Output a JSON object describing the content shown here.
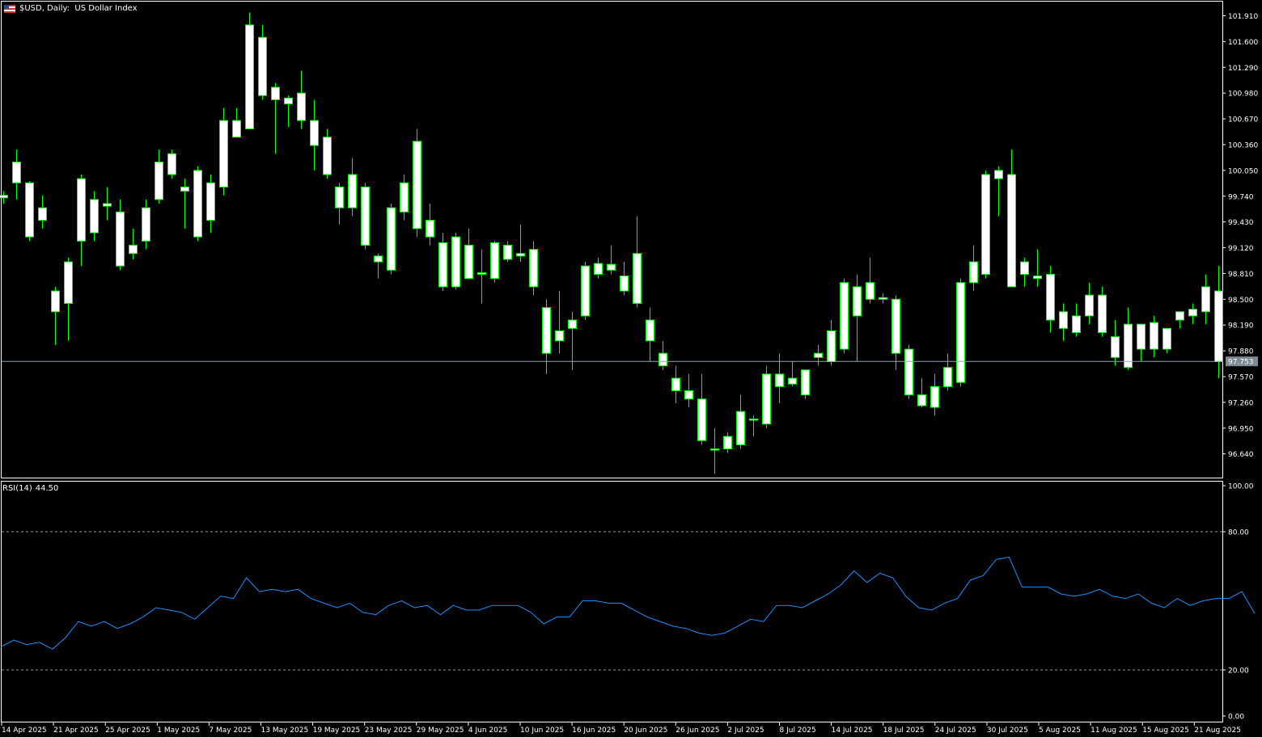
{
  "header": {
    "symbol": "$USD",
    "period": "Daily",
    "description": "US Dollar Index"
  },
  "indicator": {
    "name": "RSI(14)",
    "value": "44.50"
  },
  "current_price_label": "97.753",
  "colors": {
    "background": "#000000",
    "candle_wick": "#00ff00",
    "candle_body": "#ffffff",
    "rsi_line": "#1e90ff",
    "axis_text": "#ffffff",
    "price_line": "#8fa8b8",
    "level_line": "#9a9a9a"
  },
  "price_axis_labels": [
    "101.910",
    "101.600",
    "101.290",
    "100.980",
    "100.670",
    "100.360",
    "100.050",
    "99.740",
    "99.430",
    "99.120",
    "98.810",
    "98.500",
    "98.190",
    "97.880",
    "97.570",
    "97.260",
    "96.950",
    "96.640"
  ],
  "rsi_axis_labels": [
    "100.00",
    "80.00",
    "20.00",
    "0.00"
  ],
  "date_labels": [
    "14 Apr 2025",
    "21 Apr 2025",
    "25 Apr 2025",
    "1 May 2025",
    "7 May 2025",
    "13 May 2025",
    "19 May 2025",
    "23 May 2025",
    "29 May 2025",
    "4 Jun 2025",
    "10 Jun 2025",
    "16 Jun 2025",
    "20 Jun 2025",
    "26 Jun 2025",
    "2 Jul 2025",
    "8 Jul 2025",
    "14 Jul 2025",
    "18 Jul 2025",
    "24 Jul 2025",
    "30 Jul 2025",
    "5 Aug 2025",
    "11 Aug 2025",
    "15 Aug 2025",
    "21 Aug 2025"
  ],
  "chart_data": [
    {
      "type": "candlestick",
      "title": "$USD, Daily: US Dollar Index",
      "ylim": [
        96.3,
        102.0
      ],
      "current_price": 97.753,
      "grid": false,
      "ohlc": [
        [
          99.75,
          99.8,
          99.65,
          99.72
        ],
        [
          99.9,
          100.3,
          99.7,
          100.15
        ],
        [
          99.9,
          99.92,
          99.2,
          99.25
        ],
        [
          99.6,
          99.75,
          99.35,
          99.45
        ],
        [
          98.35,
          98.65,
          97.95,
          98.6
        ],
        [
          98.45,
          99.0,
          98.0,
          98.95
        ],
        [
          99.2,
          100.0,
          98.9,
          99.95
        ],
        [
          99.3,
          99.8,
          99.2,
          99.7
        ],
        [
          99.65,
          99.85,
          99.45,
          99.62
        ],
        [
          99.55,
          99.7,
          98.85,
          98.9
        ],
        [
          99.05,
          99.35,
          98.98,
          99.15
        ],
        [
          99.2,
          99.7,
          99.1,
          99.6
        ],
        [
          99.7,
          100.3,
          99.65,
          100.15
        ],
        [
          100.25,
          100.3,
          99.95,
          100.0
        ],
        [
          99.85,
          99.95,
          99.35,
          99.8
        ],
        [
          100.05,
          100.1,
          99.2,
          99.25
        ],
        [
          99.45,
          100.0,
          99.3,
          99.9
        ],
        [
          99.85,
          100.8,
          99.75,
          100.65
        ],
        [
          100.45,
          100.8,
          100.45,
          100.65
        ],
        [
          100.55,
          101.95,
          100.55,
          101.8
        ],
        [
          101.65,
          101.8,
          100.9,
          100.95
        ],
        [
          100.9,
          101.1,
          100.25,
          101.05
        ],
        [
          100.85,
          100.95,
          100.57,
          100.92
        ],
        [
          100.98,
          101.25,
          100.55,
          100.65
        ],
        [
          100.65,
          100.9,
          100.05,
          100.35
        ],
        [
          100.45,
          100.55,
          99.95,
          100.0
        ],
        [
          99.85,
          99.9,
          99.4,
          99.6
        ],
        [
          99.6,
          100.2,
          99.5,
          100.0
        ],
        [
          99.85,
          99.9,
          99.1,
          99.15
        ],
        [
          98.95,
          99.05,
          98.75,
          99.02
        ],
        [
          98.85,
          99.65,
          98.8,
          99.6
        ],
        [
          99.55,
          100.0,
          99.45,
          99.9
        ],
        [
          100.4,
          100.55,
          99.25,
          99.35
        ],
        [
          99.45,
          99.65,
          99.15,
          99.25
        ],
        [
          99.18,
          99.3,
          98.6,
          98.65
        ],
        [
          98.65,
          99.3,
          98.62,
          99.25
        ],
        [
          99.15,
          99.35,
          98.75,
          98.75
        ],
        [
          98.8,
          99.1,
          98.45,
          98.82
        ],
        [
          98.75,
          99.2,
          98.7,
          99.18
        ],
        [
          99.15,
          99.2,
          98.95,
          98.98
        ],
        [
          99.05,
          99.4,
          98.95,
          99.02
        ],
        [
          99.1,
          99.2,
          98.55,
          98.65
        ],
        [
          98.4,
          98.5,
          97.6,
          97.85
        ],
        [
          98.0,
          98.6,
          97.85,
          98.12
        ],
        [
          98.25,
          98.35,
          97.65,
          98.15
        ],
        [
          98.3,
          98.95,
          98.25,
          98.9
        ],
        [
          98.8,
          99.0,
          98.75,
          98.93
        ],
        [
          98.92,
          99.15,
          98.8,
          98.85
        ],
        [
          98.6,
          98.95,
          98.55,
          98.78
        ],
        [
          99.05,
          99.5,
          98.4,
          98.45
        ],
        [
          98.25,
          98.4,
          97.75,
          98.0
        ],
        [
          97.85,
          98.0,
          97.65,
          97.7
        ],
        [
          97.55,
          97.7,
          97.25,
          97.4
        ],
        [
          97.4,
          97.6,
          97.2,
          97.3
        ],
        [
          97.3,
          97.6,
          96.75,
          96.8
        ],
        [
          96.7,
          96.95,
          96.4,
          96.7
        ],
        [
          96.7,
          96.9,
          96.65,
          96.85
        ],
        [
          96.75,
          97.35,
          96.7,
          97.15
        ],
        [
          97.05,
          97.1,
          96.85,
          97.06
        ],
        [
          97.0,
          97.7,
          96.95,
          97.6
        ],
        [
          97.45,
          97.85,
          97.25,
          97.6
        ],
        [
          97.55,
          97.75,
          97.45,
          97.48
        ],
        [
          97.35,
          97.65,
          97.3,
          97.65
        ],
        [
          97.85,
          97.95,
          97.7,
          97.8
        ],
        [
          97.75,
          98.25,
          97.7,
          98.12
        ],
        [
          97.9,
          98.75,
          97.85,
          98.7
        ],
        [
          98.3,
          98.8,
          97.75,
          98.65
        ],
        [
          98.5,
          99.0,
          98.45,
          98.7
        ],
        [
          98.52,
          98.57,
          98.45,
          98.5
        ],
        [
          98.5,
          98.55,
          97.65,
          97.85
        ],
        [
          97.9,
          97.95,
          97.3,
          97.35
        ],
        [
          97.35,
          97.55,
          97.2,
          97.22
        ],
        [
          97.2,
          97.6,
          97.1,
          97.45
        ],
        [
          97.45,
          97.85,
          97.4,
          97.68
        ],
        [
          97.5,
          98.75,
          97.45,
          98.7
        ],
        [
          98.7,
          99.15,
          98.6,
          98.95
        ],
        [
          98.8,
          100.05,
          98.75,
          100.0
        ],
        [
          99.95,
          100.1,
          99.5,
          100.05
        ],
        [
          100.0,
          100.3,
          98.65,
          98.65
        ],
        [
          98.8,
          99.0,
          98.65,
          98.95
        ],
        [
          98.75,
          99.1,
          98.65,
          98.78
        ],
        [
          98.8,
          98.9,
          98.1,
          98.25
        ],
        [
          98.35,
          98.45,
          98.0,
          98.15
        ],
        [
          98.1,
          98.45,
          98.05,
          98.3
        ],
        [
          98.55,
          98.7,
          98.2,
          98.3
        ],
        [
          98.55,
          98.65,
          98.05,
          98.1
        ],
        [
          98.05,
          98.25,
          97.7,
          97.8
        ],
        [
          97.68,
          98.4,
          97.65,
          98.2
        ],
        [
          97.9,
          98.2,
          97.75,
          98.2
        ],
        [
          98.22,
          98.3,
          97.8,
          97.9
        ],
        [
          97.9,
          98.15,
          97.85,
          98.15
        ],
        [
          98.25,
          98.35,
          98.15,
          98.35
        ],
        [
          98.3,
          98.45,
          98.2,
          98.38
        ],
        [
          98.35,
          98.8,
          98.2,
          98.65
        ],
        [
          98.6,
          98.9,
          97.55,
          97.75
        ]
      ]
    },
    {
      "type": "line",
      "title": "RSI(14) 44.50",
      "ylim": [
        0,
        100
      ],
      "levels": [
        20,
        80
      ],
      "values": [
        30,
        33,
        31,
        32,
        29,
        34,
        41,
        39,
        41,
        38,
        40,
        43,
        47,
        46,
        45,
        42,
        47,
        52,
        51,
        60,
        54,
        55,
        54,
        55,
        51,
        49,
        47,
        49,
        45,
        44,
        48,
        50,
        47,
        48,
        44,
        48,
        46,
        46,
        48,
        48,
        48,
        45,
        40,
        43,
        43,
        50,
        50,
        49,
        49,
        46,
        43,
        41,
        39,
        38,
        36,
        35,
        36,
        39,
        42,
        41,
        48,
        48,
        47,
        50,
        53,
        57,
        63,
        58,
        62,
        60,
        52,
        47,
        46,
        49,
        51,
        59,
        61,
        68,
        69,
        56,
        56,
        56,
        53,
        52,
        53,
        55,
        52,
        51,
        53,
        49,
        47,
        51,
        48,
        50,
        51,
        51,
        54,
        44.5
      ]
    }
  ]
}
